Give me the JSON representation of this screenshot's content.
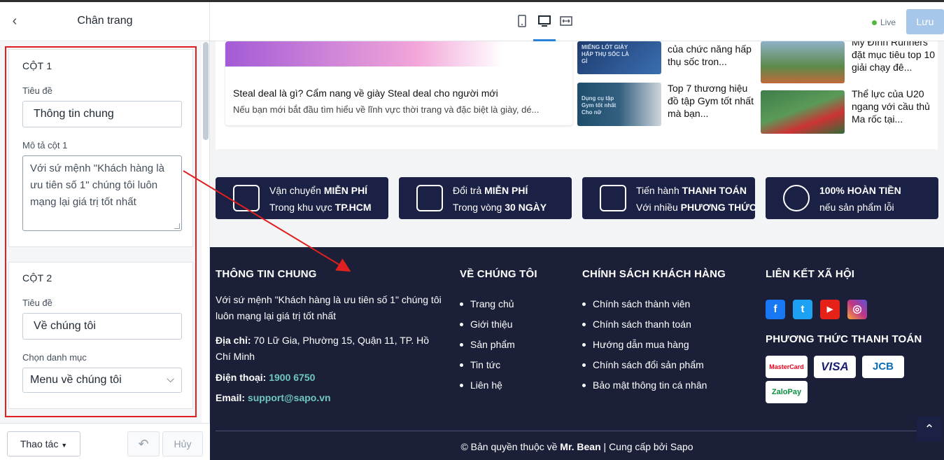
{
  "panel": {
    "title": "Chân trang",
    "back_icon": "chevron-left-icon",
    "col1": {
      "heading": "CỘT 1",
      "title_label": "Tiêu đề",
      "title_value": "Thông tin chung",
      "desc_label": "Mô tả cột 1",
      "desc_value": "Với sứ mệnh \"Khách hàng là ưu tiên số 1\" chúng tôi luôn mạng lại giá trị tốt nhất"
    },
    "col2": {
      "heading": "CỘT 2",
      "title_label": "Tiêu đề",
      "title_value": "Về chúng tôi",
      "menu_label": "Chọn danh mục",
      "menu_value": "Menu về chúng tôi"
    },
    "footer": {
      "actions_label": "Thao tác",
      "cancel_label": "Hủy"
    }
  },
  "toolbar": {
    "live_label": "Live",
    "save_label": "Lưu",
    "device_icons": [
      "mobile-icon",
      "desktop-icon",
      "fullwidth-icon"
    ]
  },
  "news": {
    "big_title": "Steal deal là gì? Cẩm nang về giày Steal deal cho người mới",
    "big_desc": "Nếu bạn mới bắt đầu tìm hiểu về lĩnh vực thời trang và đặc biệt là giày, dé...",
    "items": [
      {
        "thumb_text": "MIẾNG LÓT GIÀY HẤP THỤ SỐC LÀ GÌ",
        "title": "của chức năng hấp thụ sốc tron..."
      },
      {
        "thumb_text": "Dụng cụ tập Gym tốt nhất Cho nữ",
        "title": "Top 7 thương hiệu đồ tập Gym tốt nhất mà bạn..."
      },
      {
        "thumb_text": "",
        "title": "Mỹ Đình Runners đặt mục tiêu top 10 giải chạy đê..."
      },
      {
        "thumb_text": "",
        "title": "Thể lực của U20 ngang với cầu thủ Ma rốc tại..."
      }
    ]
  },
  "features": [
    {
      "l1_pre": "Vận chuyển ",
      "l1_bold": "MIỄN PHÍ",
      "l2_pre": "Trong khu vực ",
      "l2_bold": "TP.HCM",
      "icon": "delivery-icon"
    },
    {
      "l1_pre": "Đổi trả ",
      "l1_bold": "MIỄN PHÍ",
      "l2_pre": "Trong vòng ",
      "l2_bold": "30 NGÀY",
      "icon": "box-icon"
    },
    {
      "l1_pre": "Tiến hành ",
      "l1_bold": "THANH TOÁN",
      "l2_pre": "Với nhiều ",
      "l2_bold": "PHƯƠNG THỨC",
      "icon": "card-icon"
    },
    {
      "l1_pre": "",
      "l1_bold": "100% HOÀN TIỀN",
      "l2_pre": "nếu sản phẩm lỗi",
      "l2_bold": "",
      "icon": "refund-icon"
    }
  ],
  "site_footer": {
    "col1_title": "THÔNG TIN CHUNG",
    "col1_desc": "Với sứ mệnh \"Khách hàng là ưu tiên số 1\" chúng tôi luôn mạng lại giá trị tốt nhất",
    "address_label": "Địa chỉ:",
    "address": "70 Lữ Gia, Phường 15, Quận 11, TP. Hồ Chí Minh",
    "phone_label": "Điện thoại:",
    "phone": "1900 6750",
    "email_label": "Email:",
    "email": "support@sapo.vn",
    "col2_title": "VỀ CHÚNG TÔI",
    "col2_items": [
      "Trang chủ",
      "Giới thiệu",
      "Sản phẩm",
      "Tin tức",
      "Liên hệ"
    ],
    "col3_title": "CHÍNH SÁCH KHÁCH HÀNG",
    "col3_items": [
      "Chính sách thành viên",
      "Chính sách thanh toán",
      "Hướng dẫn mua hàng",
      "Chính sách đổi sản phẩm",
      "Bảo mật thông tin cá nhân"
    ],
    "col4_title": "LIÊN KẾT XÃ HỘI",
    "social": [
      {
        "icon": "facebook-icon",
        "glyph": "f",
        "color": "#1877f2"
      },
      {
        "icon": "twitter-icon",
        "glyph": "t",
        "color": "#1da1f2"
      },
      {
        "icon": "youtube-icon",
        "glyph": "▶",
        "color": "#e62117"
      },
      {
        "icon": "instagram-icon",
        "glyph": "◎",
        "color": "#c13584"
      }
    ],
    "pay_title": "PHƯƠNG THỨC THANH TOÁN",
    "payments": [
      {
        "name": "MasterCard",
        "color": "#eb001b"
      },
      {
        "name": "VISA",
        "color": "#1a1f71"
      },
      {
        "name": "JCB",
        "color": "#0b6db3"
      },
      {
        "name": "ZaloPay",
        "color": "#0a8f3f"
      }
    ],
    "copyright_pre": "© Bản quyền thuộc về ",
    "copyright_brand": "Mr. Bean",
    "copyright_post": " | Cung cấp bởi Sapo"
  },
  "colors": {
    "highlight": "#e02020",
    "footer_bg": "#1b2038",
    "accent": "#6fc7c0",
    "save_btn": "#a7c7ea"
  }
}
